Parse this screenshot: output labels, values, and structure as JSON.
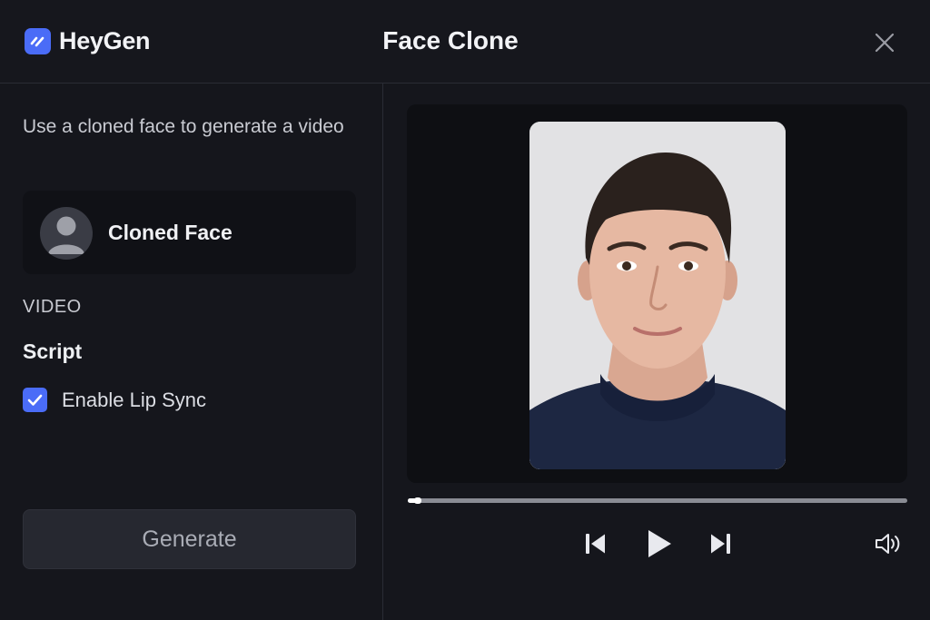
{
  "app": {
    "name": "HeyGen"
  },
  "dialog": {
    "title": "Face Clone"
  },
  "left_panel": {
    "description": "Use a cloned face to generate a video",
    "face_card": {
      "label": "Cloned Face"
    },
    "section_label": "VIDEO",
    "script_label": "Script",
    "lip_sync": {
      "label": "Enable Lip Sync",
      "checked": true
    },
    "generate_label": "Generate"
  },
  "player": {
    "progress": 0.02,
    "controls": [
      "skip-back-icon",
      "play-icon",
      "skip-forward-icon",
      "volume-icon"
    ]
  },
  "colors": {
    "accent": "#4a6cf7",
    "background": "#15161c",
    "panel": "#101116"
  }
}
